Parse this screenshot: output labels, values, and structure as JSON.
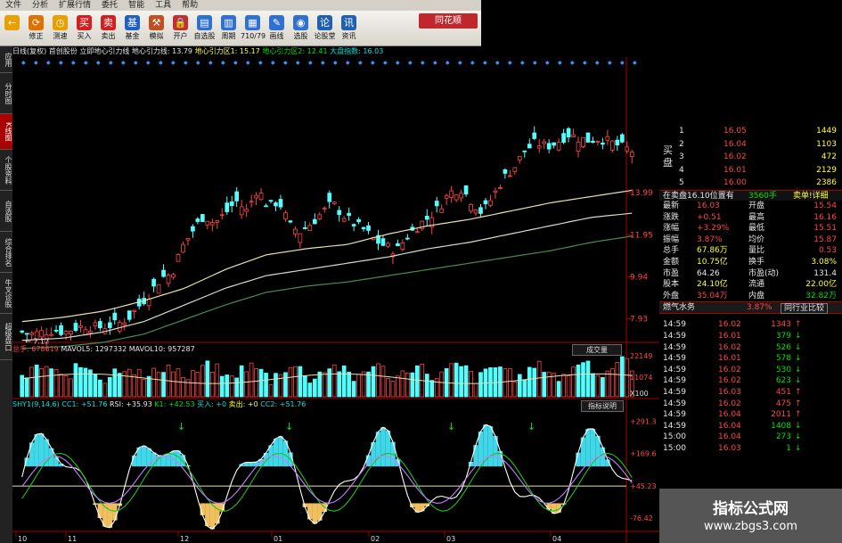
{
  "menu": [
    "文件",
    "分析",
    "扩展行情",
    "委托",
    "智能",
    "工具",
    "帮助"
  ],
  "toolbar": [
    {
      "icon": "back-arrow-icon",
      "label": ""
    },
    {
      "icon": "refresh-icon",
      "label": "修正"
    },
    {
      "icon": "clock-icon",
      "label": "测速"
    },
    {
      "icon": "buy-icon",
      "label": "买入"
    },
    {
      "icon": "sell-icon",
      "label": "卖出"
    },
    {
      "icon": "fund-icon",
      "label": "基金"
    },
    {
      "icon": "hammer-icon",
      "label": "模拟"
    },
    {
      "icon": "lock-icon",
      "label": "开户"
    },
    {
      "icon": "watchlist-icon",
      "label": "自选股"
    },
    {
      "icon": "period-icon",
      "label": "周期"
    },
    {
      "icon": "period-710-icon",
      "label": "710/79"
    },
    {
      "icon": "draw-icon",
      "label": "画线"
    },
    {
      "icon": "stock-select-icon",
      "label": "选股"
    },
    {
      "icon": "forum-icon",
      "label": "论股堂"
    },
    {
      "icon": "news-icon",
      "label": "资讯"
    }
  ],
  "brand": "同花顺",
  "infobar": {
    "mode": "日线(复权)",
    "stock": "首创股份",
    "indicator": "立即地心引力线 地心引力线: 13.79",
    "zone1": "地心引力区1: 15.17",
    "zone2": "地心引力区2: 12.41",
    "market": "大盘指数: 16.03"
  },
  "left_tabs": [
    "应用",
    "分时图",
    "K线图",
    "个股资料",
    "自选股",
    "综合排名",
    "牛叉诊股",
    "超级盘口"
  ],
  "price_axis": [
    "13.99",
    "11.95",
    "9.94",
    "7.93"
  ],
  "price_low_label": "7.17",
  "x_labels": [
    "10",
    "11",
    "12",
    "01",
    "02",
    "03",
    "04"
  ],
  "volume_header": {
    "total": "总手: 678619",
    "ma5": "MAVOL5: 1297332",
    "ma10": "MAVOL10: 957287",
    "button": "成交量"
  },
  "volume_axis": [
    "22149",
    "11074",
    "X100"
  ],
  "indicator_header": {
    "name": "SHY1(9,14,6)",
    "cc1": "CC1: +51.76",
    "rsi": "RSI: +35.93",
    "k1": "K1: +42.53",
    "buy": "买入: +0",
    "sell": "卖出: +0",
    "cc2": "CC2: +51.76",
    "button": "指标说明"
  },
  "indicator_axis": [
    "+291.3",
    "+169.6",
    "+45.23",
    "-76.42"
  ],
  "order_book": {
    "sell": [
      {
        "level": "1",
        "price": "16.05",
        "vol": "1449"
      },
      {
        "level": "2",
        "price": "16.04",
        "vol": "1103"
      },
      {
        "level": "3",
        "price": "16.02",
        "vol": "472"
      },
      {
        "level": "4",
        "price": "16.01",
        "vol": "2129"
      },
      {
        "level": "5",
        "price": "16.00",
        "vol": "2386"
      }
    ],
    "sell_label": "买盘",
    "pending": "在卖盘16.10位置有",
    "pending_vol": "3560手",
    "pending_btn": "卖单!详细"
  },
  "quote": [
    {
      "k1": "最新",
      "v1": "16.03",
      "k2": "开盘",
      "v2": "15.54"
    },
    {
      "k1": "涨跌",
      "v1": "+0.51",
      "k2": "最高",
      "v2": "16.16"
    },
    {
      "k1": "涨幅",
      "v1": "+3.29%",
      "k2": "最低",
      "v2": "15.51"
    },
    {
      "k1": "振幅",
      "v1": "3.87%",
      "k2": "均价",
      "v2": "15.87"
    },
    {
      "k1": "总手",
      "v1": "67.86万",
      "k2": "量比",
      "v2": "0.53"
    },
    {
      "k1": "金额",
      "v1": "10.75亿",
      "k2": "换手",
      "v2": "3.08%"
    },
    {
      "k1": "市盈",
      "v1": "64.26",
      "k2": "市盈(动)",
      "v2": "131.4"
    },
    {
      "k1": "股本",
      "v1": "24.10亿",
      "k2": "流通",
      "v2": "22.00亿"
    },
    {
      "k1": "外盘",
      "v1": "35.04万",
      "k2": "内盘",
      "v2": "32.82万"
    }
  ],
  "sector": {
    "name": "燃气水务",
    "change": "3.87%",
    "button": "同行业比较"
  },
  "ticks": [
    {
      "time": "14:59",
      "price": "16.02",
      "vol": "1343"
    },
    {
      "time": "14:59",
      "price": "16.01",
      "vol": "379"
    },
    {
      "time": "14:59",
      "price": "16.02",
      "vol": "526"
    },
    {
      "time": "14:59",
      "price": "16.01",
      "vol": "578"
    },
    {
      "time": "14:59",
      "price": "16.02",
      "vol": "530"
    },
    {
      "time": "14:59",
      "price": "16.02",
      "vol": "623"
    },
    {
      "time": "14:59",
      "price": "16.03",
      "vol": "451"
    },
    {
      "time": "14:59",
      "price": "16.02",
      "vol": "475"
    },
    {
      "time": "14:59",
      "price": "16.04",
      "vol": "2011"
    },
    {
      "time": "14:59",
      "price": "16.04",
      "vol": "1408"
    },
    {
      "time": "15:00",
      "price": "16.04",
      "vol": "273"
    },
    {
      "time": "15:00",
      "price": "16.03",
      "vol": "1"
    }
  ],
  "watermark": {
    "title": "指标公式网",
    "url": "www.zbgs3.com"
  },
  "chart_data": {
    "type": "candlestick",
    "title": "",
    "ylim": [
      6.8,
      17.2
    ],
    "bars": 126,
    "close_path": [
      7.3,
      7.2,
      7.3,
      7.4,
      7.3,
      7.5,
      7.6,
      7.5,
      7.6,
      7.7,
      8.0,
      8.6,
      9.2,
      9.9,
      10.1,
      11.4,
      12.2,
      12.9,
      12.5,
      13.0,
      13.6,
      13.1,
      14.2,
      13.3,
      13.6,
      12.4,
      12.1,
      12.5,
      13.0,
      13.5,
      12.9,
      12.5,
      12.2,
      11.7,
      11.4,
      11.2,
      11.9,
      12.4,
      12.8,
      13.3,
      14.0,
      14.2,
      13.6,
      13.0,
      13.8,
      14.7,
      15.2,
      16.0,
      16.4,
      16.2,
      16.4,
      16.8,
      16.6,
      16.5,
      16.6,
      16.4,
      16.2,
      16.0
    ],
    "gravity_upper": [
      7.8,
      8.0,
      8.3,
      8.8,
      9.4,
      10.3,
      11.0,
      11.3,
      11.5,
      12.0,
      12.4,
      12.7,
      13.1,
      13.5,
      13.8,
      14.1
    ],
    "gravity_mid": [
      6.9,
      7.0,
      7.3,
      7.8,
      8.6,
      9.4,
      10.0,
      10.3,
      10.6,
      10.9,
      11.3,
      11.6,
      12.0,
      12.4,
      12.8,
      13.0
    ],
    "gravity_lower": [
      6.5,
      6.6,
      6.8,
      7.2,
      7.9,
      8.6,
      9.2,
      9.5,
      9.7,
      10.0,
      10.3,
      10.6,
      10.9,
      11.2,
      11.6,
      11.9
    ],
    "volume_ylim": [
      0,
      22149
    ],
    "indicator_ylim": [
      -120,
      320
    ]
  }
}
